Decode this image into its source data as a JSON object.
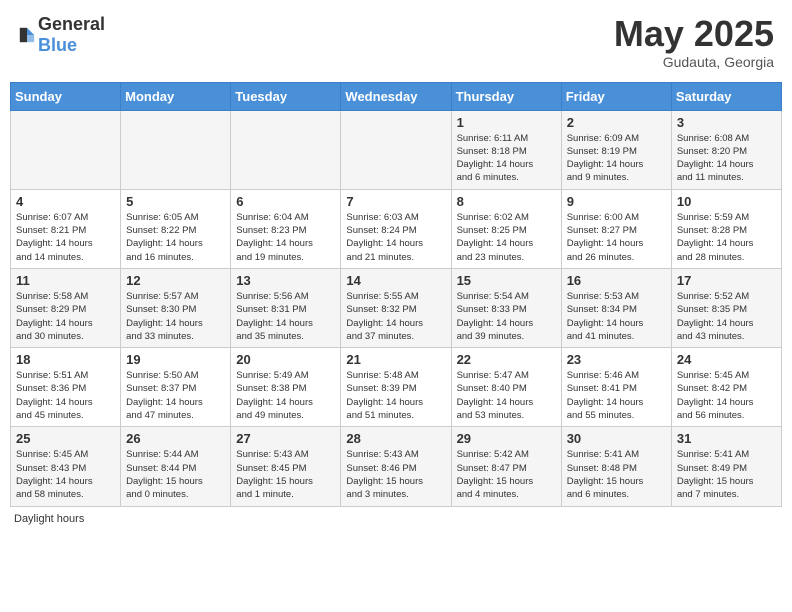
{
  "header": {
    "logo_general": "General",
    "logo_blue": "Blue",
    "title": "May 2025",
    "location": "Gudauta, Georgia"
  },
  "days_of_week": [
    "Sunday",
    "Monday",
    "Tuesday",
    "Wednesday",
    "Thursday",
    "Friday",
    "Saturday"
  ],
  "weeks": [
    [
      {
        "day": "",
        "info": ""
      },
      {
        "day": "",
        "info": ""
      },
      {
        "day": "",
        "info": ""
      },
      {
        "day": "",
        "info": ""
      },
      {
        "day": "1",
        "info": "Sunrise: 6:11 AM\nSunset: 8:18 PM\nDaylight: 14 hours\nand 6 minutes."
      },
      {
        "day": "2",
        "info": "Sunrise: 6:09 AM\nSunset: 8:19 PM\nDaylight: 14 hours\nand 9 minutes."
      },
      {
        "day": "3",
        "info": "Sunrise: 6:08 AM\nSunset: 8:20 PM\nDaylight: 14 hours\nand 11 minutes."
      }
    ],
    [
      {
        "day": "4",
        "info": "Sunrise: 6:07 AM\nSunset: 8:21 PM\nDaylight: 14 hours\nand 14 minutes."
      },
      {
        "day": "5",
        "info": "Sunrise: 6:05 AM\nSunset: 8:22 PM\nDaylight: 14 hours\nand 16 minutes."
      },
      {
        "day": "6",
        "info": "Sunrise: 6:04 AM\nSunset: 8:23 PM\nDaylight: 14 hours\nand 19 minutes."
      },
      {
        "day": "7",
        "info": "Sunrise: 6:03 AM\nSunset: 8:24 PM\nDaylight: 14 hours\nand 21 minutes."
      },
      {
        "day": "8",
        "info": "Sunrise: 6:02 AM\nSunset: 8:25 PM\nDaylight: 14 hours\nand 23 minutes."
      },
      {
        "day": "9",
        "info": "Sunrise: 6:00 AM\nSunset: 8:27 PM\nDaylight: 14 hours\nand 26 minutes."
      },
      {
        "day": "10",
        "info": "Sunrise: 5:59 AM\nSunset: 8:28 PM\nDaylight: 14 hours\nand 28 minutes."
      }
    ],
    [
      {
        "day": "11",
        "info": "Sunrise: 5:58 AM\nSunset: 8:29 PM\nDaylight: 14 hours\nand 30 minutes."
      },
      {
        "day": "12",
        "info": "Sunrise: 5:57 AM\nSunset: 8:30 PM\nDaylight: 14 hours\nand 33 minutes."
      },
      {
        "day": "13",
        "info": "Sunrise: 5:56 AM\nSunset: 8:31 PM\nDaylight: 14 hours\nand 35 minutes."
      },
      {
        "day": "14",
        "info": "Sunrise: 5:55 AM\nSunset: 8:32 PM\nDaylight: 14 hours\nand 37 minutes."
      },
      {
        "day": "15",
        "info": "Sunrise: 5:54 AM\nSunset: 8:33 PM\nDaylight: 14 hours\nand 39 minutes."
      },
      {
        "day": "16",
        "info": "Sunrise: 5:53 AM\nSunset: 8:34 PM\nDaylight: 14 hours\nand 41 minutes."
      },
      {
        "day": "17",
        "info": "Sunrise: 5:52 AM\nSunset: 8:35 PM\nDaylight: 14 hours\nand 43 minutes."
      }
    ],
    [
      {
        "day": "18",
        "info": "Sunrise: 5:51 AM\nSunset: 8:36 PM\nDaylight: 14 hours\nand 45 minutes."
      },
      {
        "day": "19",
        "info": "Sunrise: 5:50 AM\nSunset: 8:37 PM\nDaylight: 14 hours\nand 47 minutes."
      },
      {
        "day": "20",
        "info": "Sunrise: 5:49 AM\nSunset: 8:38 PM\nDaylight: 14 hours\nand 49 minutes."
      },
      {
        "day": "21",
        "info": "Sunrise: 5:48 AM\nSunset: 8:39 PM\nDaylight: 14 hours\nand 51 minutes."
      },
      {
        "day": "22",
        "info": "Sunrise: 5:47 AM\nSunset: 8:40 PM\nDaylight: 14 hours\nand 53 minutes."
      },
      {
        "day": "23",
        "info": "Sunrise: 5:46 AM\nSunset: 8:41 PM\nDaylight: 14 hours\nand 55 minutes."
      },
      {
        "day": "24",
        "info": "Sunrise: 5:45 AM\nSunset: 8:42 PM\nDaylight: 14 hours\nand 56 minutes."
      }
    ],
    [
      {
        "day": "25",
        "info": "Sunrise: 5:45 AM\nSunset: 8:43 PM\nDaylight: 14 hours\nand 58 minutes."
      },
      {
        "day": "26",
        "info": "Sunrise: 5:44 AM\nSunset: 8:44 PM\nDaylight: 15 hours\nand 0 minutes."
      },
      {
        "day": "27",
        "info": "Sunrise: 5:43 AM\nSunset: 8:45 PM\nDaylight: 15 hours\nand 1 minute."
      },
      {
        "day": "28",
        "info": "Sunrise: 5:43 AM\nSunset: 8:46 PM\nDaylight: 15 hours\nand 3 minutes."
      },
      {
        "day": "29",
        "info": "Sunrise: 5:42 AM\nSunset: 8:47 PM\nDaylight: 15 hours\nand 4 minutes."
      },
      {
        "day": "30",
        "info": "Sunrise: 5:41 AM\nSunset: 8:48 PM\nDaylight: 15 hours\nand 6 minutes."
      },
      {
        "day": "31",
        "info": "Sunrise: 5:41 AM\nSunset: 8:49 PM\nDaylight: 15 hours\nand 7 minutes."
      }
    ]
  ],
  "footer": {
    "label": "Daylight hours"
  }
}
